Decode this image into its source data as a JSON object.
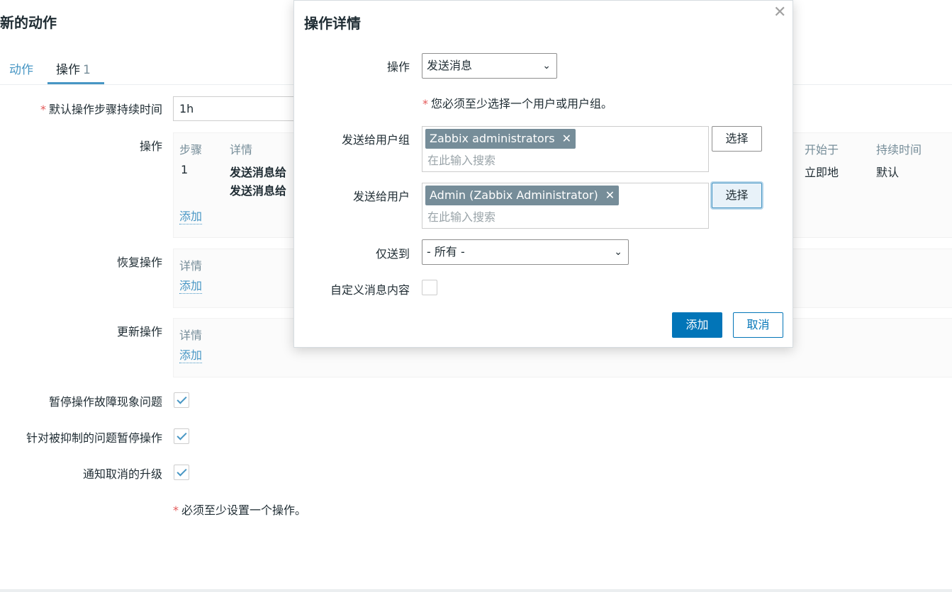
{
  "page": {
    "title": "新的动作"
  },
  "tabs": [
    {
      "label": "动作"
    },
    {
      "label": "操作",
      "count": "1"
    }
  ],
  "form": {
    "step_duration": {
      "label": "默认操作步骤持续时间",
      "value": "1h"
    },
    "operations": {
      "label": "操作",
      "headers": {
        "steps": "步骤",
        "details": "详情",
        "start_in": "开始于",
        "duration": "持续时间"
      },
      "row": {
        "step": "1",
        "detail_line1": "发送消息给",
        "detail_line2": "发送消息给",
        "start_in": "立即地",
        "duration": "默认"
      },
      "add_label": "添加"
    },
    "recovery": {
      "label": "恢复操作",
      "header": "详情",
      "add_label": "添加"
    },
    "update": {
      "label": "更新操作",
      "header": "详情",
      "add_label": "添加"
    },
    "pause_symptoms": {
      "label": "暂停操作故障现象问题",
      "checked": true
    },
    "pause_suppressed": {
      "label": "针对被抑制的问题暂停操作",
      "checked": true
    },
    "notify_cancelled": {
      "label": "通知取消的升级",
      "checked": true
    },
    "note": "必须至少设置一个操作。"
  },
  "dialog": {
    "title": "操作详情",
    "close_icon": "close-icon",
    "operation": {
      "label": "操作",
      "value": "发送消息"
    },
    "required_note": "您必须至少选择一个用户或用户组。",
    "send_to_groups": {
      "label": "发送给用户组",
      "chip": "Zabbix administrators",
      "placeholder": "在此输入搜索",
      "select_label": "选择"
    },
    "send_to_users": {
      "label": "发送给用户",
      "chip": "Admin (Zabbix Administrator)",
      "placeholder": "在此输入搜索",
      "select_label": "选择"
    },
    "send_only_to": {
      "label": "仅送到",
      "value": "- 所有 -"
    },
    "custom_message": {
      "label": "自定义消息内容",
      "checked": false
    },
    "add_label": "添加",
    "cancel_label": "取消"
  },
  "colors": {
    "accent": "#4796c4",
    "primary_button": "#0275b8",
    "chip": "#768d99",
    "required": "#e45959"
  }
}
